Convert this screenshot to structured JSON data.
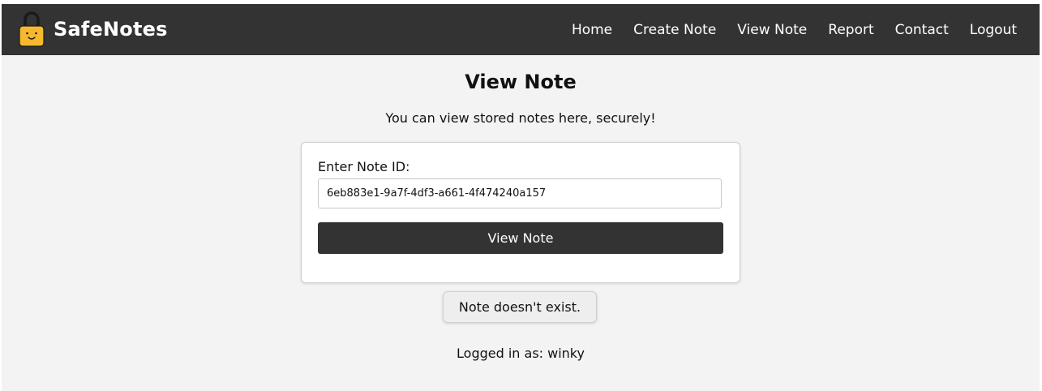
{
  "brand": {
    "name": "SafeNotes",
    "logo_icon": "padlock-smiley-icon",
    "logo_color": "#f5b82e"
  },
  "nav": {
    "items": [
      {
        "label": "Home"
      },
      {
        "label": "Create Note"
      },
      {
        "label": "View Note"
      },
      {
        "label": "Report"
      },
      {
        "label": "Contact"
      },
      {
        "label": "Logout"
      }
    ]
  },
  "page": {
    "title": "View Note",
    "subtitle": "You can view stored notes here, securely!"
  },
  "form": {
    "label": "Enter Note ID:",
    "note_id_value": "6eb883e1-9a7f-4df3-a661-4f474240a157",
    "button_label": "View Note"
  },
  "status": {
    "message": "Note doesn't exist.",
    "logged_in_text": "Logged in as: winky"
  },
  "colors": {
    "navbar": "#333333",
    "background": "#f3f3f3",
    "button": "#333333"
  }
}
